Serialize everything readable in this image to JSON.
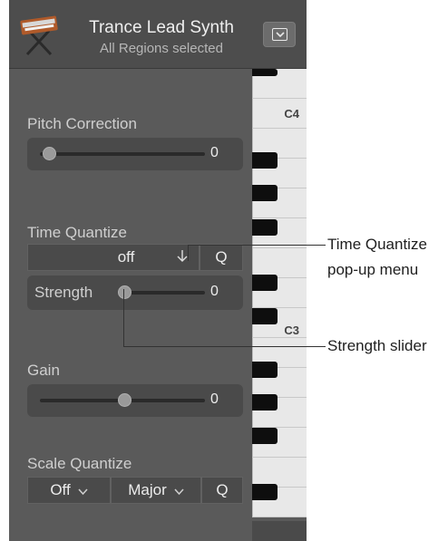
{
  "header": {
    "title": "Trance Lead Synth",
    "subtitle": "All Regions selected",
    "icon": "synth-keyboard-icon",
    "menu_icon": "chevron-down-icon"
  },
  "pitch_correction": {
    "label": "Pitch Correction",
    "value": "0",
    "level": 0.0
  },
  "time_quantize": {
    "label": "Time Quantize",
    "selected": "off",
    "q_label": "Q",
    "strength_label": "Strength",
    "strength_value": "0",
    "strength_level": 0.0
  },
  "gain": {
    "label": "Gain",
    "value": "0",
    "level": 0.5
  },
  "scale_quantize": {
    "label": "Scale Quantize",
    "root": "Off",
    "scale": "Major",
    "q_label": "Q"
  },
  "piano": {
    "labels": {
      "c4": "C4",
      "c3": "C3"
    }
  },
  "callouts": {
    "time_quantize_line1": "Time Quantize",
    "time_quantize_line2": "pop-up menu",
    "strength": "Strength slider"
  },
  "colors": {
    "panel": "#5a5a5a",
    "header": "#4d4d4d",
    "well": "#4a4a4a",
    "white_key": "#e8e8e8",
    "black_key": "#0e0e0e"
  }
}
